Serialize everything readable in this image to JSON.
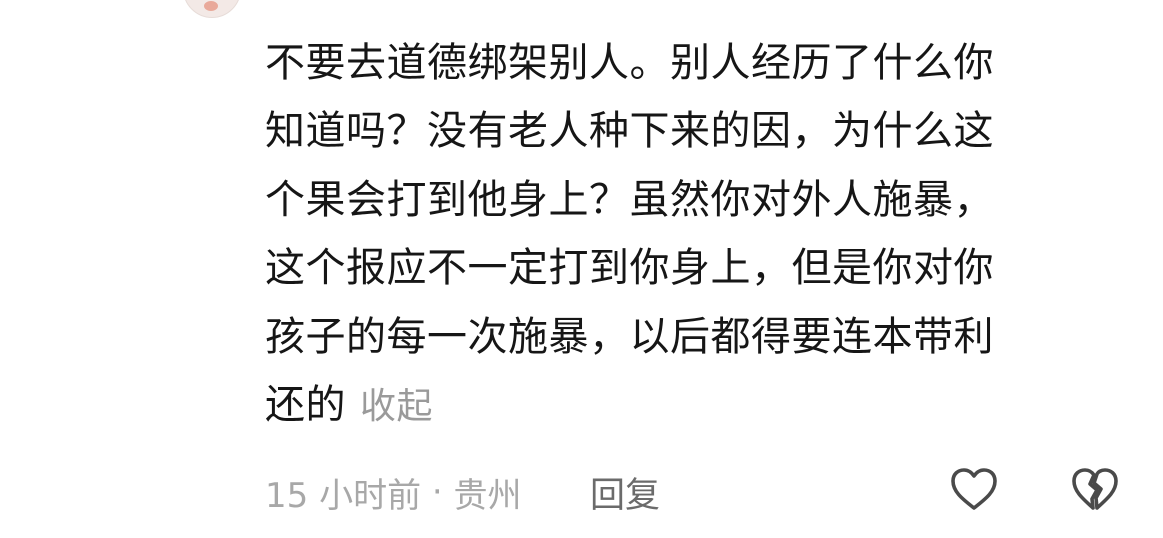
{
  "comment": {
    "lines": [
      "不要去道德绑架别人。别人经历了什么你",
      "知道吗？没有老人种下来的因，为什么这",
      "个果会打到他身上？虽然你对外人施暴，",
      "这个报应不一定打到你身上，但是你对你",
      "孩子的每一次施暴，以后都得要连本带利",
      "还的"
    ],
    "collapse_label": "收起"
  },
  "meta": {
    "time": "15 小时前",
    "separator": " · ",
    "location": "贵州",
    "reply_label": "回复"
  },
  "icons": {
    "like": "heart-outline-icon",
    "dislike": "broken-heart-outline-icon"
  },
  "colors": {
    "text": "#161616",
    "muted": "#a8a8a8",
    "reply": "#6b6b6b",
    "icon": "#4a4a4a"
  }
}
